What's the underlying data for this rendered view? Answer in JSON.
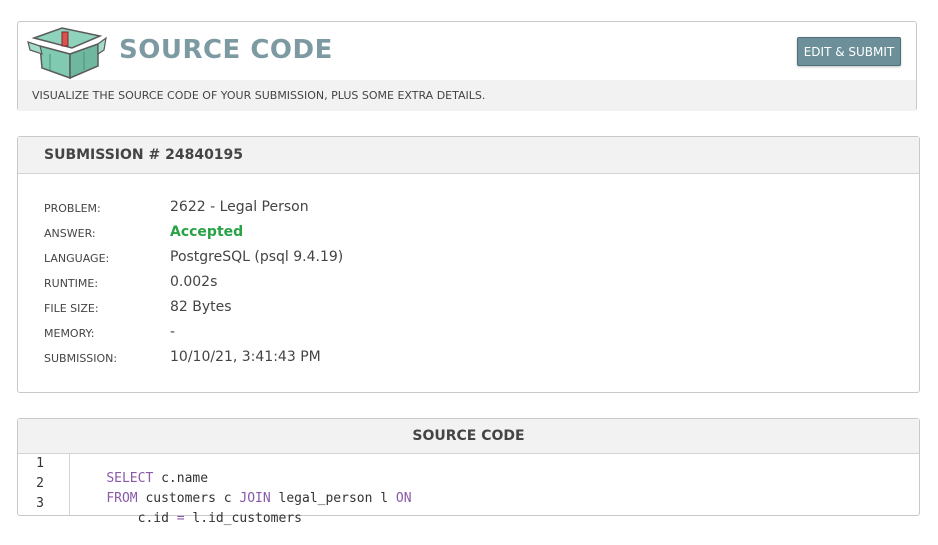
{
  "header": {
    "title": "SOURCE CODE",
    "button_label": "EDIT & SUBMIT",
    "subtitle": "VISUALIZE THE SOURCE CODE OF YOUR SUBMISSION, PLUS SOME EXTRA DETAILS."
  },
  "submission": {
    "heading": "SUBMISSION # 24840195",
    "rows": [
      {
        "label": "PROBLEM:",
        "value": "2622 - Legal Person"
      },
      {
        "label": "ANSWER:",
        "value": "Accepted"
      },
      {
        "label": "LANGUAGE:",
        "value": "PostgreSQL (psql 9.4.19)"
      },
      {
        "label": "RUNTIME:",
        "value": "0.002s"
      },
      {
        "label": "FILE SIZE:",
        "value": "82 Bytes"
      },
      {
        "label": "MEMORY:",
        "value": "-"
      },
      {
        "label": "SUBMISSION:",
        "value": "10/10/21, 3:41:43 PM"
      }
    ]
  },
  "source_code": {
    "heading": "SOURCE CODE",
    "line_numbers": [
      "1",
      "2",
      "3"
    ],
    "lines": [
      [
        {
          "t": "SELECT",
          "k": true
        },
        {
          "t": " c.name",
          "k": false
        }
      ],
      [
        {
          "t": "FROM",
          "k": true
        },
        {
          "t": " customers c ",
          "k": false
        },
        {
          "t": "JOIN",
          "k": true
        },
        {
          "t": " legal_person l ",
          "k": false
        },
        {
          "t": "ON",
          "k": true
        }
      ],
      [
        {
          "t": "    c.id ",
          "k": false
        },
        {
          "t": "=",
          "k": true
        },
        {
          "t": " l.id_customers",
          "k": false
        }
      ]
    ]
  },
  "colors": {
    "title": "#7d9aa3",
    "button": "#6c8f99",
    "accepted": "#27a244",
    "keyword": "#8a5aa8"
  }
}
